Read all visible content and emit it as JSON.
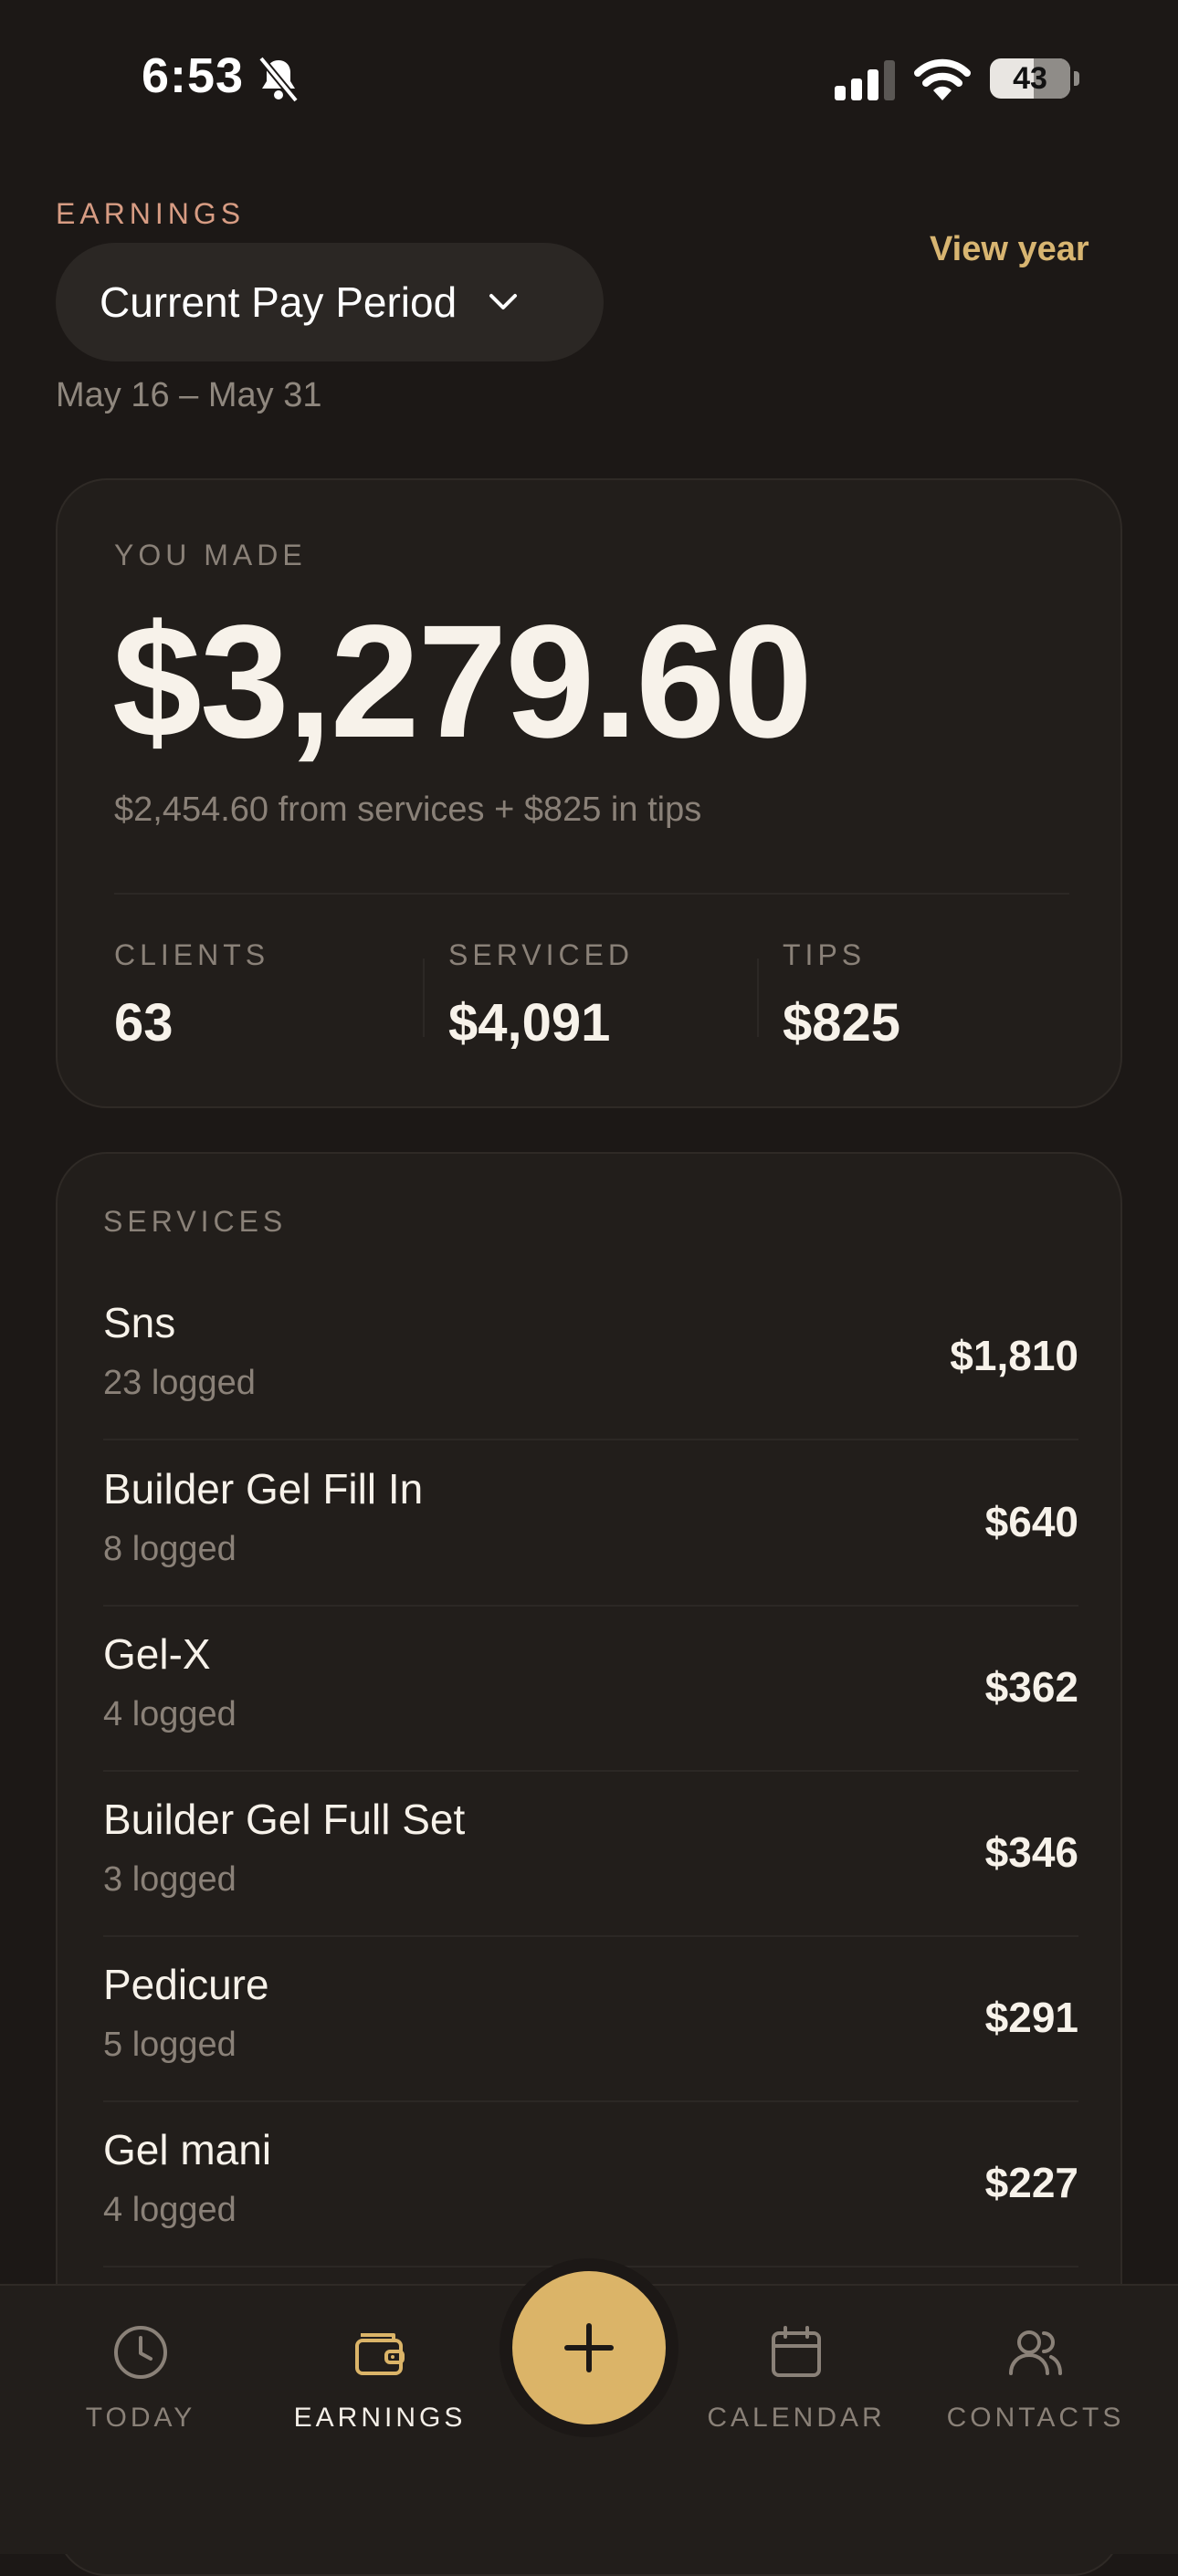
{
  "status_bar": {
    "time": "6:53",
    "battery": "43"
  },
  "header": {
    "eyebrow": "EARNINGS",
    "period_selector": "Current Pay Period",
    "view_year": "View year",
    "date_range": "May 16 – May 31"
  },
  "summary": {
    "label": "YOU MADE",
    "amount": "$3,279.60",
    "breakdown": "$2,454.60 from services + $825 in tips",
    "stats": [
      {
        "label": "CLIENTS",
        "value": "63"
      },
      {
        "label": "SERVICED",
        "value": "$4,091"
      },
      {
        "label": "TIPS",
        "value": "$825"
      }
    ]
  },
  "services": {
    "label": "SERVICES",
    "items": [
      {
        "name": "Sns",
        "count": "23 logged",
        "amount": "$1,810"
      },
      {
        "name": "Builder Gel Fill In",
        "count": "8 logged",
        "amount": "$640"
      },
      {
        "name": "Gel-X",
        "count": "4 logged",
        "amount": "$362"
      },
      {
        "name": "Builder Gel Full Set",
        "count": "3 logged",
        "amount": "$346"
      },
      {
        "name": "Pedicure",
        "count": "5 logged",
        "amount": "$291"
      },
      {
        "name": "Gel mani",
        "count": "4 logged",
        "amount": "$227"
      }
    ]
  },
  "tabbar": {
    "tabs": [
      {
        "label": "TODAY",
        "icon": "clock-icon"
      },
      {
        "label": "EARNINGS",
        "icon": "wallet-icon",
        "active": true
      },
      {
        "label": "CALENDAR",
        "icon": "calendar-icon"
      },
      {
        "label": "CONTACTS",
        "icon": "contacts-icon"
      }
    ],
    "fab_icon": "plus-icon"
  },
  "colors": {
    "background": "#1c1816",
    "card": "#221e1b",
    "accent_gold": "#dbb468",
    "eyebrow": "#d79c83",
    "muted": "#8a8178"
  }
}
